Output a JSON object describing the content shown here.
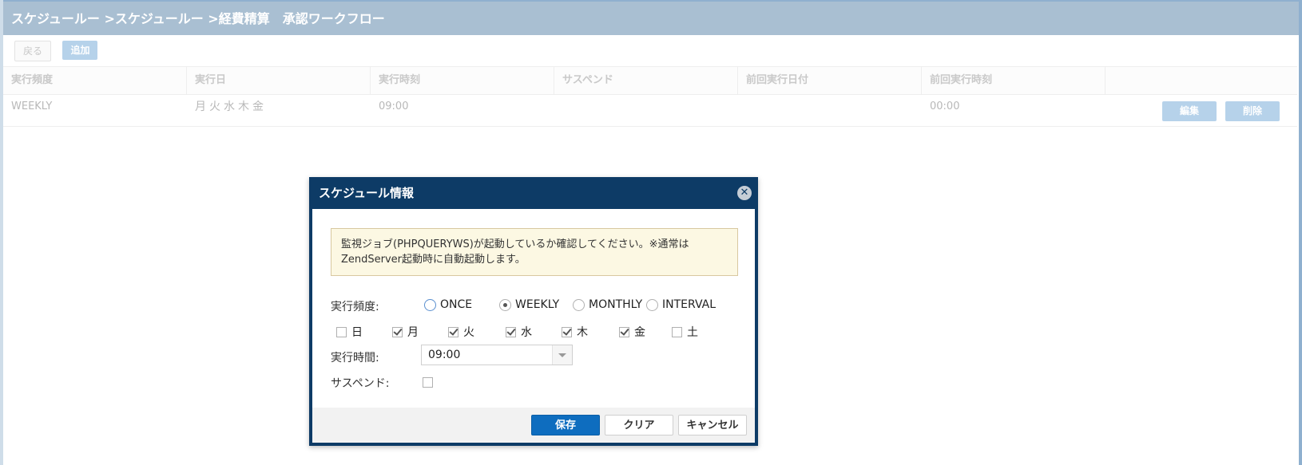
{
  "page": {
    "breadcrumb": "スケジュールー >スケジュールー >経費精算　承認ワークフロー",
    "toolbar": {
      "back_label": "戻る",
      "add_label": "追加"
    },
    "table": {
      "headers": [
        "実行頻度",
        "実行日",
        "実行時刻",
        "サスペンド",
        "前回実行日付",
        "前回実行時刻",
        ""
      ],
      "rows": [
        {
          "frequency": "WEEKLY",
          "days": "月火水木金",
          "time": "09:00",
          "suspend": "",
          "last_date": "",
          "last_time": "00:00",
          "edit_label": "編集",
          "delete_label": "削除"
        }
      ]
    }
  },
  "dialog": {
    "title": "スケジュール情報",
    "notice": "監視ジョブ(PHPQUERYWS)が起動しているか確認してください。※通常はZendServer起動時に自動起動します。",
    "frequency_label": "実行頻度:",
    "frequency_options": [
      {
        "label": "ONCE",
        "checked": false
      },
      {
        "label": "WEEKLY",
        "checked": true
      },
      {
        "label": "MONTHLY",
        "checked": false
      },
      {
        "label": "INTERVAL",
        "checked": false
      }
    ],
    "days": [
      {
        "label": "日",
        "checked": false
      },
      {
        "label": "月",
        "checked": true
      },
      {
        "label": "火",
        "checked": true
      },
      {
        "label": "水",
        "checked": true
      },
      {
        "label": "木",
        "checked": true
      },
      {
        "label": "金",
        "checked": true
      },
      {
        "label": "土",
        "checked": false
      }
    ],
    "time_label": "実行時間:",
    "time_value": "09:00",
    "suspend_label": "サスペンド:",
    "suspend_checked": false,
    "buttons": {
      "save": "保存",
      "clear": "クリア",
      "cancel": "キャンセル"
    }
  },
  "colors": {
    "titlebar": "#a9bfd2",
    "dialog_header": "#0d3b66",
    "primary_button": "#0e6dbf",
    "disabled_button": "#b6d2ea",
    "notice_bg": "#fcf8e3"
  }
}
